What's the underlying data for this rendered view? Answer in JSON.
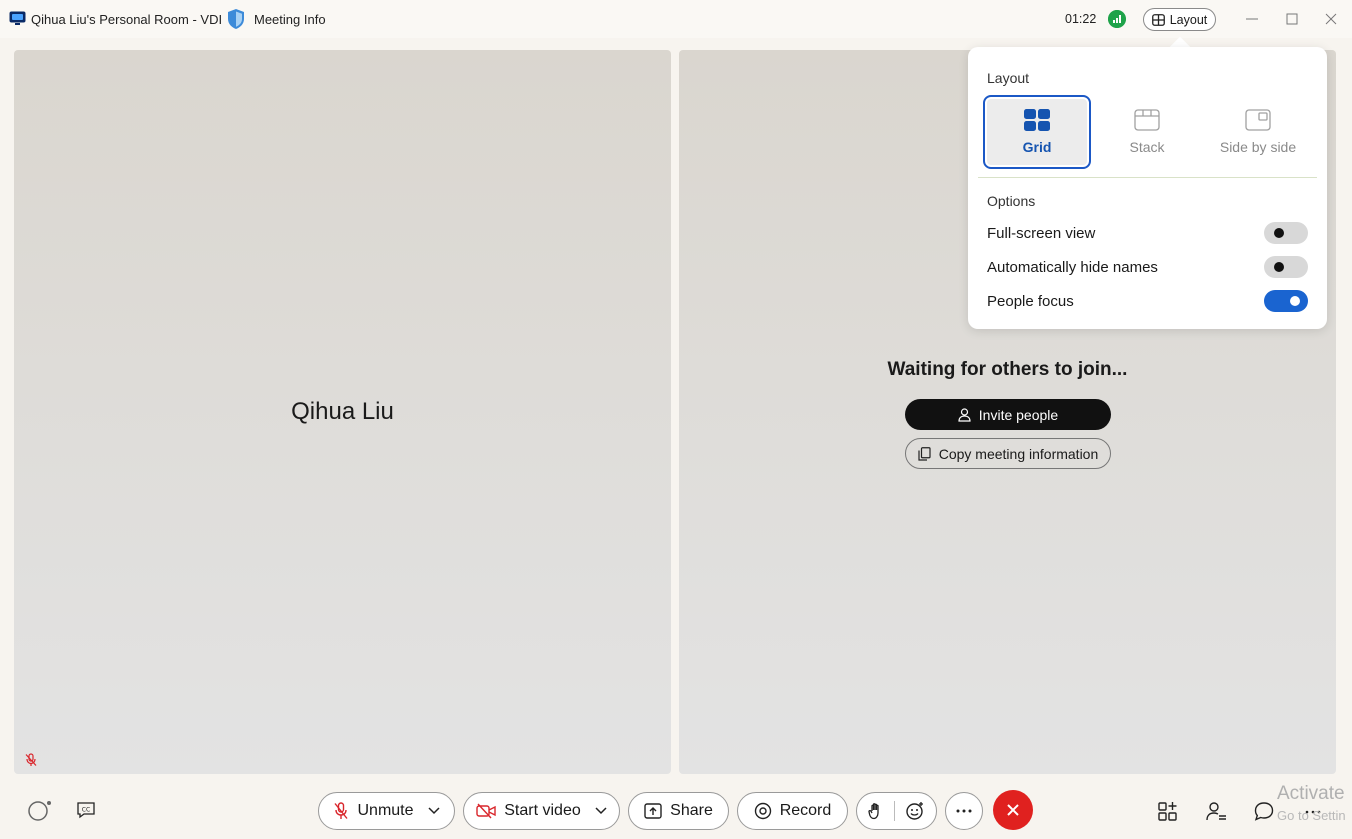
{
  "titlebar": {
    "window_title": "Qihua Liu's Personal Room - VDI",
    "meeting_info_label": "Meeting Info",
    "timer": "01:22",
    "layout_button_label": "Layout"
  },
  "tiles": {
    "left": {
      "participant_name": "Qihua Liu"
    },
    "right": {
      "waiting_text": "Waiting for others to join...",
      "invite_label": "Invite people",
      "copy_label": "Copy meeting information"
    }
  },
  "layout_popover": {
    "heading": "Layout",
    "layouts": [
      {
        "label": "Grid",
        "selected": true
      },
      {
        "label": "Stack",
        "selected": false
      },
      {
        "label": "Side by side",
        "selected": false
      }
    ],
    "options_heading": "Options",
    "options": [
      {
        "label": "Full-screen view",
        "on": false
      },
      {
        "label": "Automatically hide names",
        "on": false
      },
      {
        "label": "People focus",
        "on": true
      }
    ]
  },
  "controls": {
    "unmute_label": "Unmute",
    "start_video_label": "Start video",
    "share_label": "Share",
    "record_label": "Record"
  },
  "watermark": {
    "line1": "Activate",
    "line2": "Go to Settin"
  },
  "colors": {
    "accent": "#1a64d0",
    "end_call": "#e0211f",
    "signal": "#1fa34a",
    "muted_red": "#d9262c"
  }
}
